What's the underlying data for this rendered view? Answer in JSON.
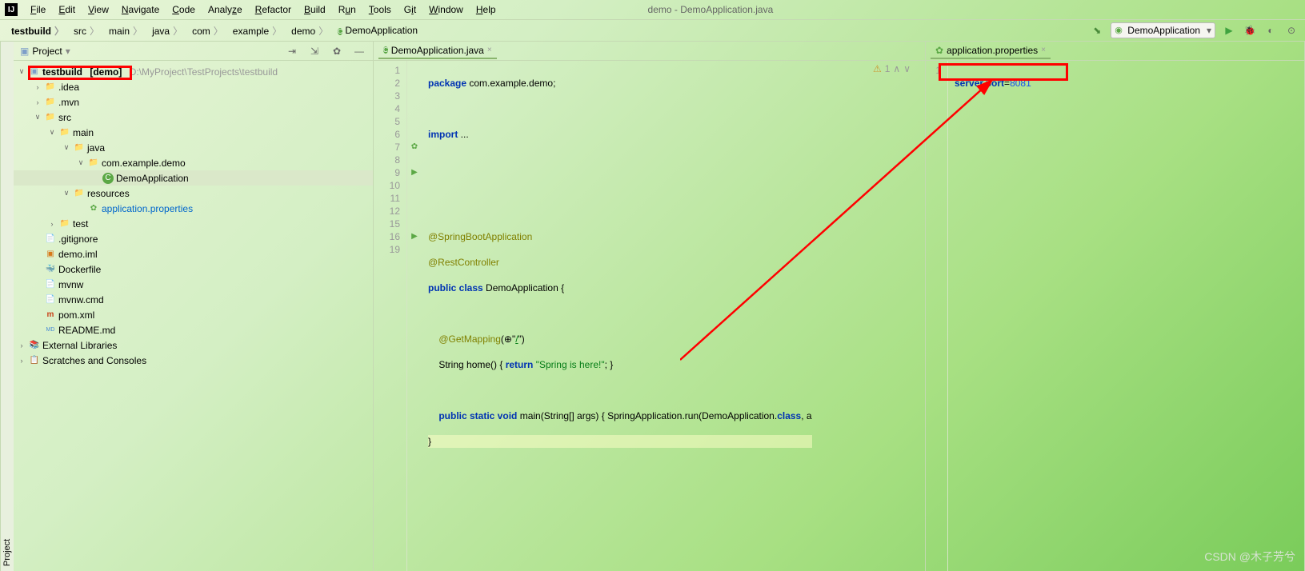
{
  "window": {
    "title": "demo - DemoApplication.java"
  },
  "menu": [
    "File",
    "Edit",
    "View",
    "Navigate",
    "Code",
    "Analyze",
    "Refactor",
    "Build",
    "Run",
    "Tools",
    "Git",
    "Window",
    "Help"
  ],
  "breadcrumbs": [
    "testbuild",
    "src",
    "main",
    "java",
    "com",
    "example",
    "demo",
    "DemoApplication"
  ],
  "run_config": "DemoApplication",
  "project_panel": {
    "title": "Project"
  },
  "tree": {
    "root": {
      "name": "testbuild",
      "tag": "[demo]",
      "path": "D:\\MyProject\\TestProjects\\testbuild"
    },
    "idea": ".idea",
    "mvn": ".mvn",
    "src": "src",
    "main": "main",
    "java": "java",
    "pkg": "com.example.demo",
    "app": "DemoApplication",
    "resources": "resources",
    "props": "application.properties",
    "test": "test",
    "gitignore": ".gitignore",
    "iml": "demo.iml",
    "docker": "Dockerfile",
    "mvnw": "mvnw",
    "mvnwcmd": "mvnw.cmd",
    "pom": "pom.xml",
    "readme": "README.md",
    "extlib": "External Libraries",
    "scratches": "Scratches and Consoles"
  },
  "tabs": {
    "left": "DemoApplication.java",
    "right": "application.properties"
  },
  "code_left": {
    "lines": [
      "1",
      "2",
      "3",
      "4",
      "5",
      "6",
      "7",
      "8",
      "9",
      "10",
      "11",
      "12",
      "15",
      "16",
      "19"
    ],
    "l1a": "package",
    "l1b": " com.example.demo;",
    "l3a": "import",
    "l3b": " ...",
    "l7": "@SpringBootApplication",
    "l8": "@RestController",
    "l9a": "public class",
    "l9b": " DemoApplication ",
    "l9c": "{",
    "l11a": "    @GetMapping",
    "l11b": "(⊕\"",
    "l11c": "/",
    "l11d": "\")",
    "l12a": "    String home() { ",
    "l12b": "return",
    "l12c": " \"Spring is here!\"",
    "l12d": "; }",
    "l16a": "    public static void",
    "l16b": " main(String[] args) { SpringApplication.run(DemoApplication.",
    "l16c": "class",
    "l16d": ", a",
    "l19": "}"
  },
  "code_right": {
    "lines": [
      "1"
    ],
    "l1a": "server.port",
    "l1b": "=",
    "l1c": "8081"
  },
  "inspection": {
    "count": "1"
  },
  "watermark": "CSDN @木子芳兮"
}
